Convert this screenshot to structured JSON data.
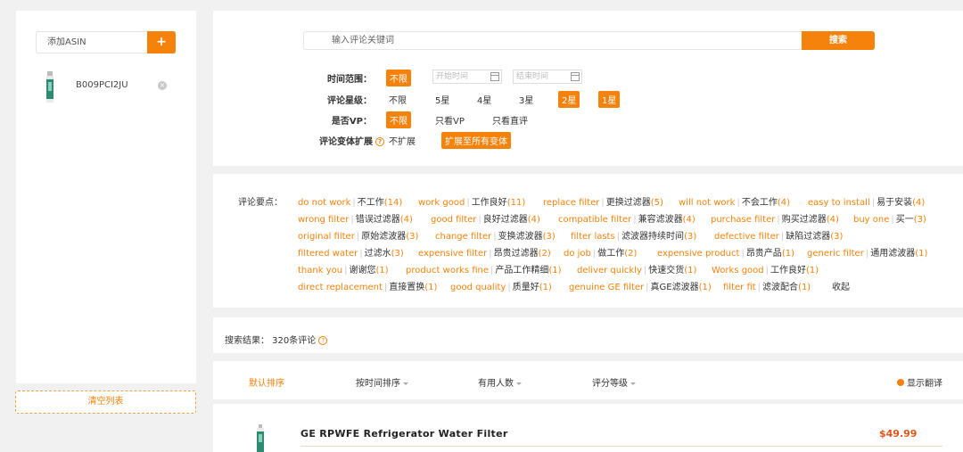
{
  "sidebar": {
    "add_placeholder": "添加ASIN",
    "add_button": "+",
    "items": [
      {
        "asin": "B009PCI2JU"
      }
    ],
    "remove_icon": "×",
    "clear_label": "清空列表"
  },
  "search": {
    "placeholder": "输入评论关键词",
    "button": "搜索"
  },
  "filters": {
    "time": {
      "label": "时间范围：",
      "selected": "不限",
      "start_placeholder": "开始时间",
      "end_placeholder": "结束时间"
    },
    "rating": {
      "label": "评论星级：",
      "options": [
        "不限",
        "5星",
        "4星",
        "3星",
        "2星",
        "1星"
      ],
      "selected": [
        "2星",
        "1星"
      ]
    },
    "vp": {
      "label": "是否VP：",
      "options": [
        "不限",
        "只看VP",
        "只看直评"
      ],
      "selected": "不限"
    },
    "variant": {
      "label": "评论变体扩展",
      "options": [
        "不扩展",
        "扩展至所有变体"
      ],
      "selected": "扩展至所有变体",
      "help_icon": "?"
    }
  },
  "points": {
    "label": "评论要点：",
    "rows": [
      [
        {
          "en": "do not work",
          "zh": "不工作",
          "cnt": "(14)"
        },
        {
          "en": "work good",
          "zh": "工作良好",
          "cnt": "(11)"
        },
        {
          "en": "replace filter",
          "zh": "更换过滤器",
          "cnt": "(5)"
        },
        {
          "en": "will not work",
          "zh": "不会工作",
          "cnt": "(4)"
        },
        {
          "en": "easy to install",
          "zh": "易于安装",
          "cnt": "(4)"
        }
      ],
      [
        {
          "en": "wrong filter",
          "zh": "错误过滤器",
          "cnt": "(4)"
        },
        {
          "en": "good filter",
          "zh": "良好过滤器",
          "cnt": "(4)"
        },
        {
          "en": "compatible filter",
          "zh": "兼容滤波器",
          "cnt": "(4)"
        },
        {
          "en": "purchase filter",
          "zh": "购买过滤器",
          "cnt": "(4)"
        },
        {
          "en": "buy one",
          "zh": "买一",
          "cnt": "(3)"
        }
      ],
      [
        {
          "en": "original filter",
          "zh": "原始滤波器",
          "cnt": "(3)"
        },
        {
          "en": "change filter",
          "zh": "变换滤波器",
          "cnt": "(3)"
        },
        {
          "en": "filter lasts",
          "zh": "滤波器持续时间",
          "cnt": "(3)"
        },
        {
          "en": "defective filter",
          "zh": "缺陷过滤器",
          "cnt": "(3)"
        }
      ],
      [
        {
          "en": "filtered water",
          "zh": "过滤水",
          "cnt": "(3)"
        },
        {
          "en": "expensive filter",
          "zh": "昂贵过滤器",
          "cnt": "(2)"
        },
        {
          "en": "do job",
          "zh": "做工作",
          "cnt": "(2)"
        },
        {
          "en": "expensive product",
          "zh": "昂贵产品",
          "cnt": "(1)"
        },
        {
          "en": "generic filter",
          "zh": "通用滤波器",
          "cnt": "(1)"
        }
      ],
      [
        {
          "en": "thank you",
          "zh": "谢谢您",
          "cnt": "(1)"
        },
        {
          "en": "product works fine",
          "zh": "产品工作精细",
          "cnt": "(1)"
        },
        {
          "en": "deliver quickly",
          "zh": "快速交货",
          "cnt": "(1)"
        },
        {
          "en": "Works good",
          "zh": "工作良好",
          "cnt": "(1)"
        }
      ],
      [
        {
          "en": "direct replacement",
          "zh": "直接置换",
          "cnt": "(1)"
        },
        {
          "en": "good quality",
          "zh": "质量好",
          "cnt": "(1)"
        },
        {
          "en": "genuine GE filter",
          "zh": "真GE滤波器",
          "cnt": "(1)"
        },
        {
          "en": "filter fit",
          "zh": "滤波配合",
          "cnt": "(1)"
        }
      ]
    ],
    "collapse": "收起"
  },
  "result": {
    "text": "搜索结果：  320条评论",
    "help_icon": "?"
  },
  "sort": {
    "items": [
      "默认排序",
      "按时间排序",
      "有用人数",
      "评分等级"
    ],
    "active": "默认排序",
    "translate": "显示翻译"
  },
  "product": {
    "title": "GE RPWFE Refrigerator Water Filter",
    "price": "$49.99"
  },
  "colors": {
    "accent": "#f5820b",
    "price": "#e0551c"
  }
}
